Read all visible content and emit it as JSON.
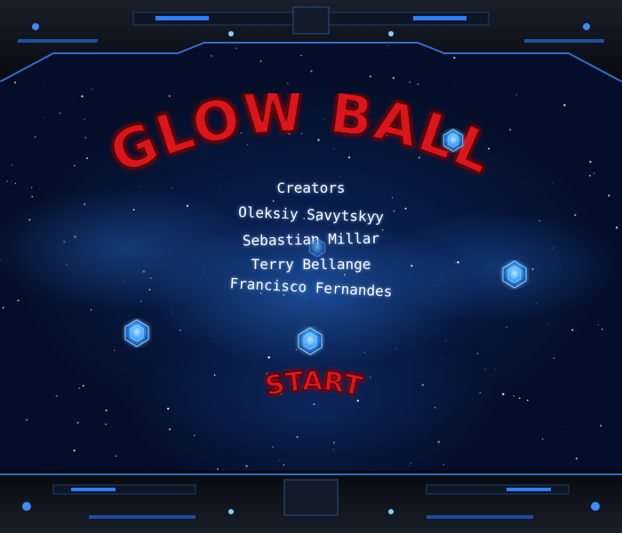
{
  "game": {
    "title": "GLOW BALL",
    "credits_heading": "Creators",
    "creators": [
      "Oleksiy Savytskyy",
      "Sebastian Millar",
      "Terry Bellange",
      "Francisco Fernandes"
    ],
    "start_label": "START"
  },
  "colors": {
    "title_red": "#d8121a",
    "text_white": "#ffffff",
    "space_blue": "#0c2864",
    "gem_blue": "#3aa0ff"
  },
  "icons": {
    "gem": "glowing-blue-gem-icon",
    "frame": "spaceship-console-frame"
  }
}
